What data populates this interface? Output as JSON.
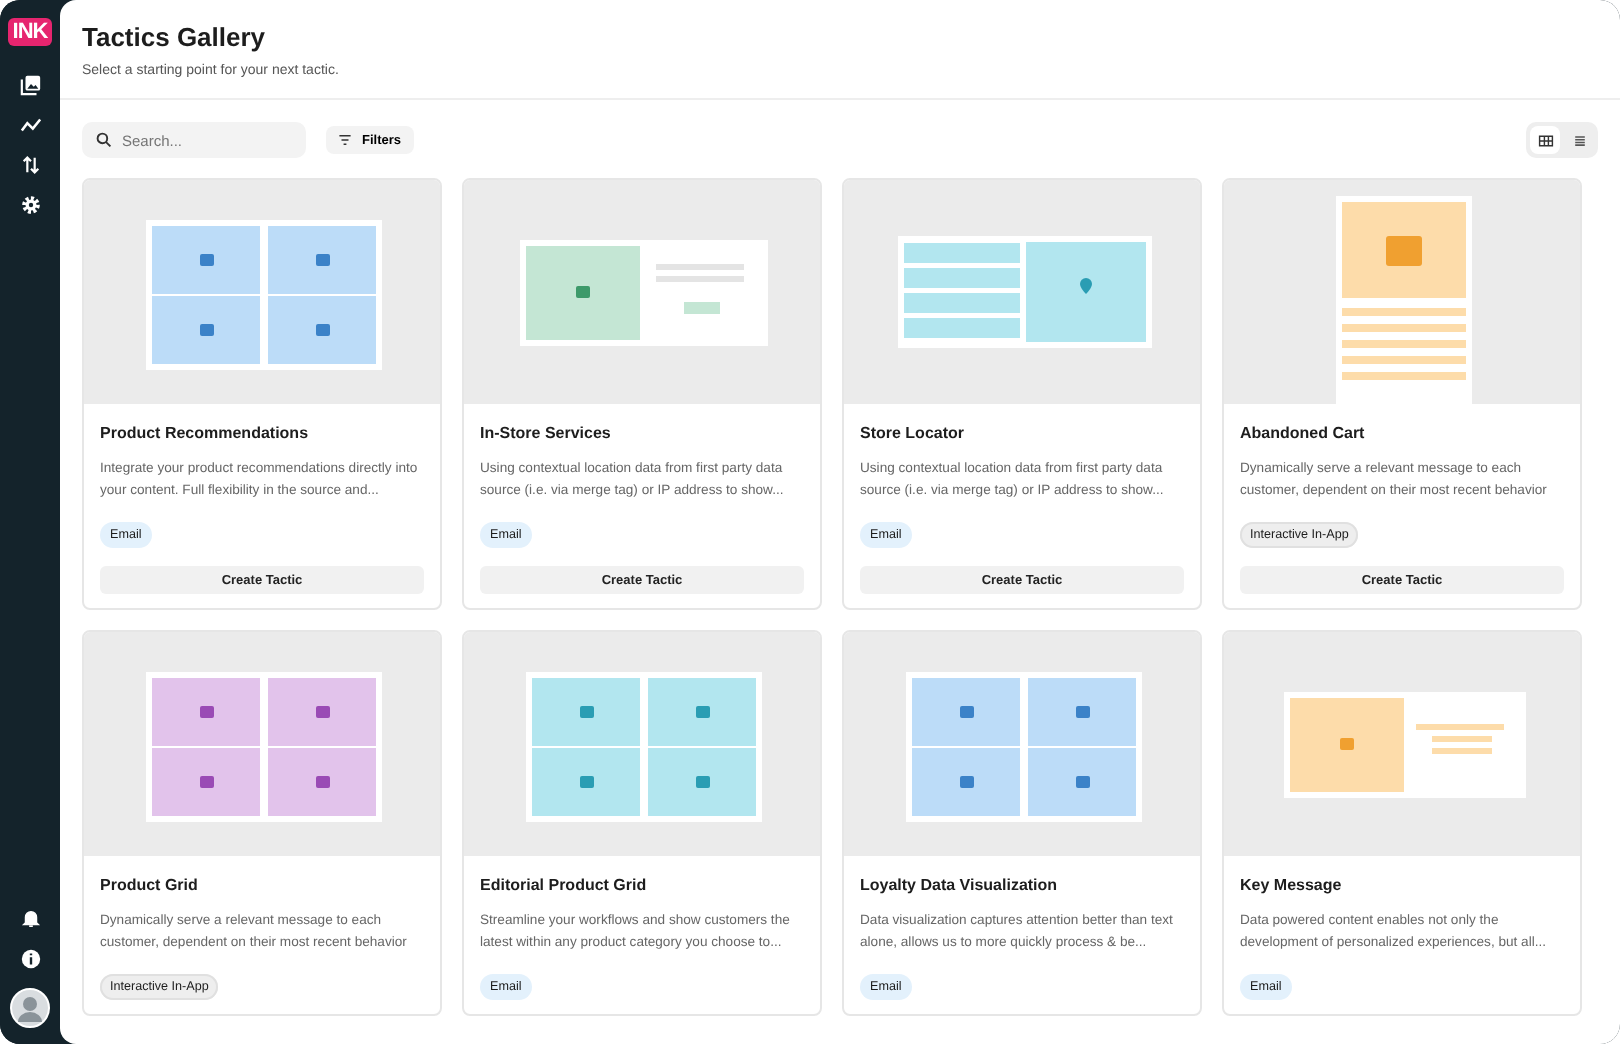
{
  "sidebar": {
    "logo": "INK"
  },
  "header": {
    "title": "Tactics Gallery",
    "subtitle": "Select a starting point for your next tactic."
  },
  "toolbar": {
    "search": {
      "placeholder": "Search..."
    },
    "filters": "Filters",
    "views": [
      {
        "kind": "grid",
        "selected": true
      },
      {
        "kind": "list",
        "selected": false
      }
    ]
  },
  "cards": [
    {
      "title": "Product Recommendations",
      "description": "Integrate your product recommendations directly into your content. Full flexibility in the source and...",
      "tag": {
        "label": "Email",
        "kind": "email"
      },
      "button": "Create Tactic",
      "thumbnail": {
        "kind": "grid",
        "color": "#bcdcf8"
      }
    },
    {
      "title": "In-Store Services",
      "description": "Using contextual location data from first party data source (i.e. via merge tag) or IP address to show...",
      "tag": {
        "label": "Email",
        "kind": "email"
      },
      "button": "Create Tactic",
      "thumbnail": {
        "kind": "split",
        "color": "#c4e6d4"
      }
    },
    {
      "title": "Store Locator",
      "description": "Using contextual location data from first party data source (i.e. via merge tag) or IP address to show...",
      "tag": {
        "label": "Email",
        "kind": "email"
      },
      "button": "Create Tactic",
      "thumbnail": {
        "kind": "map",
        "color": "#b2e6ef"
      }
    },
    {
      "title": "Abandoned Cart",
      "description": "Dynamically serve a relevant message to each customer, dependent on their most recent behavior",
      "tag": {
        "label": "Interactive In-App",
        "kind": "interactive"
      },
      "button": "Create Tactic",
      "thumbnail": {
        "kind": "cart",
        "color": "#fddcaa"
      }
    },
    {
      "title": "Product Grid",
      "description": "Dynamically serve a relevant message to each customer, dependent on their most recent behavior",
      "tag": {
        "label": "Interactive In-App",
        "kind": "interactive"
      },
      "thumbnail": {
        "kind": "grid",
        "color": "#e2c3eb"
      }
    },
    {
      "title": "Editorial Product Grid",
      "description": "Streamline your workflows and show customers the latest within any product category you choose to...",
      "tag": {
        "label": "Email",
        "kind": "email"
      },
      "thumbnail": {
        "kind": "grid",
        "color": "#b2e6ef"
      }
    },
    {
      "title": "Loyalty Data Visualization",
      "description": "Data visualization captures attention better than text alone, allows us to more quickly process & be...",
      "tag": {
        "label": "Email",
        "kind": "email"
      },
      "thumbnail": {
        "kind": "grid",
        "color": "#bcdcf8"
      }
    },
    {
      "title": "Key Message",
      "description": "Data powered content enables not only the development of personalized experiences, but all...",
      "tag": {
        "label": "Email",
        "kind": "email"
      },
      "thumbnail": {
        "kind": "banner",
        "color": "#fddcaa"
      }
    }
  ]
}
